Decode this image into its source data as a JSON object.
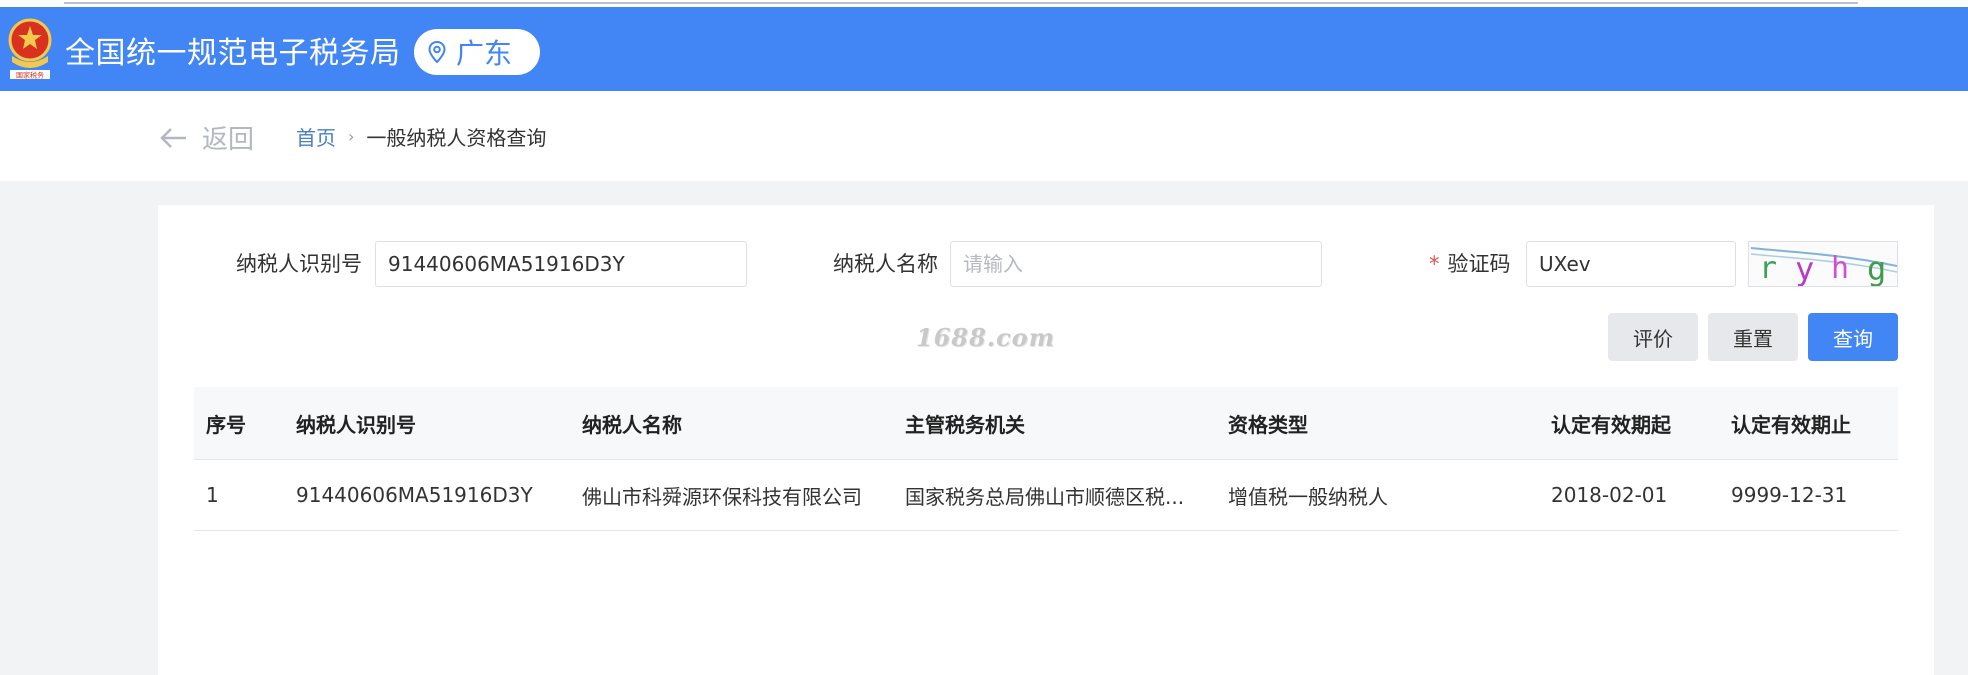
{
  "header": {
    "site_title": "全国统一规范电子税务局",
    "region": "广东",
    "emblem_text": "国家税务"
  },
  "subnav": {
    "back_label": "返回",
    "breadcrumb_home": "首页",
    "breadcrumb_separator": "›",
    "breadcrumb_current": "一般纳税人资格查询"
  },
  "form": {
    "taxpayer_id_label": "纳税人识别号",
    "taxpayer_id_value": "91440606MA51916D3Y",
    "taxpayer_name_label": "纳税人名称",
    "taxpayer_name_placeholder": "请输入",
    "captcha_required_mark": "*",
    "captcha_label": "验证码",
    "captcha_value": "UXev",
    "captcha_image_text": "ryhg"
  },
  "watermark": "1688.com",
  "buttons": {
    "evaluate": "评价",
    "reset": "重置",
    "query": "查询"
  },
  "table": {
    "columns": [
      "序号",
      "纳税人识别号",
      "纳税人名称",
      "主管税务机关",
      "资格类型",
      "认定有效期起",
      "认定有效期止"
    ],
    "rows": [
      [
        "1",
        "91440606MA51916D3Y",
        "佛山市科舜源环保科技有限公司",
        "国家税务总局佛山市顺德区税...",
        "增值税一般纳税人",
        "2018-02-01",
        "9999-12-31"
      ]
    ]
  },
  "colors": {
    "brand_blue": "#4285f4",
    "required_red": "#e34d4d",
    "page_bg": "#f2f3f5"
  }
}
